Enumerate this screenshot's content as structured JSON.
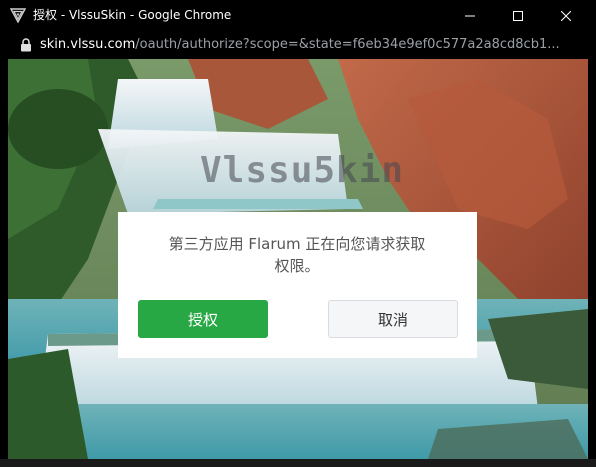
{
  "window": {
    "title": "授权 - VlssuSkin - Google Chrome",
    "controls": {
      "minimize": "minimize-icon",
      "maximize": "maximize-icon",
      "close": "close-icon"
    }
  },
  "address": {
    "host": "skin.vlssu.com",
    "path": "/oauth/authorize?scope=&state=f6eb34e9ef0c577a2a8cd8cb1..."
  },
  "page": {
    "watermark": "Vlssu5kin"
  },
  "dialog": {
    "message_line1": "第三方应用 Flarum 正在向您请求获取",
    "message_line2": "权限。",
    "authorize_label": "授权",
    "cancel_label": "取消"
  },
  "colors": {
    "authorize": "#28a745",
    "cancel_bg": "#f5f6f7",
    "titlebar": "#000000"
  }
}
